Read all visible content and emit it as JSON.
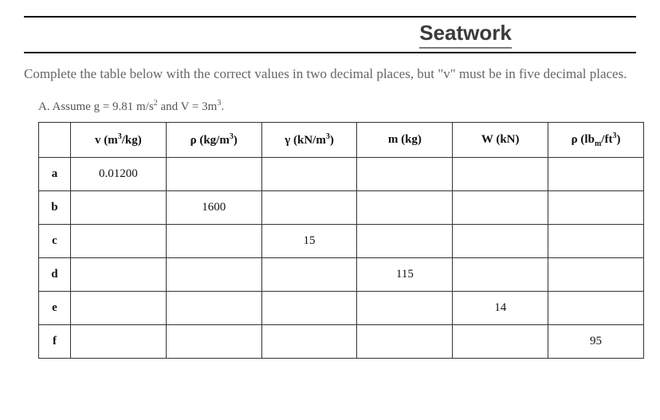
{
  "title": "Seatwork",
  "instructions": "Complete the table below with the correct values in two decimal places, but \"v\" must be in five decimal places.",
  "assume_prefix": "A. Assume g = 9.81 m/s",
  "assume_mid": " and V = 3m",
  "assume_suffix": ".",
  "headers": {
    "v_label": "v (m",
    "v_unit_end": "/kg)",
    "rho_label": "ρ (kg/m",
    "rho_unit_end": ")",
    "gamma_label": "γ (kN/m",
    "gamma_unit_end": ")",
    "m_label": "m (kg)",
    "W_label": "W (kN)",
    "rhoi_label": "ρ (lb",
    "rhoi_sub": "m",
    "rhoi_mid": "/ft",
    "rhoi_end": ")"
  },
  "rows": [
    {
      "label": "a",
      "v": "0.01200",
      "rho": "",
      "gamma": "",
      "m": "",
      "W": "",
      "rhoi": ""
    },
    {
      "label": "b",
      "v": "",
      "rho": "1600",
      "gamma": "",
      "m": "",
      "W": "",
      "rhoi": ""
    },
    {
      "label": "c",
      "v": "",
      "rho": "",
      "gamma": "15",
      "m": "",
      "W": "",
      "rhoi": ""
    },
    {
      "label": "d",
      "v": "",
      "rho": "",
      "gamma": "",
      "m": "115",
      "W": "",
      "rhoi": ""
    },
    {
      "label": "e",
      "v": "",
      "rho": "",
      "gamma": "",
      "m": "",
      "W": "14",
      "rhoi": ""
    },
    {
      "label": "f",
      "v": "",
      "rho": "",
      "gamma": "",
      "m": "",
      "W": "",
      "rhoi": "95"
    }
  ],
  "chart_data": {
    "type": "table",
    "title": "Seatwork",
    "columns": [
      "v (m³/kg)",
      "ρ (kg/m³)",
      "γ (kN/m³)",
      "m (kg)",
      "W (kN)",
      "ρ (lbm/ft³)"
    ],
    "rows": {
      "a": [
        0.012,
        null,
        null,
        null,
        null,
        null
      ],
      "b": [
        null,
        1600,
        null,
        null,
        null,
        null
      ],
      "c": [
        null,
        null,
        15,
        null,
        null,
        null
      ],
      "d": [
        null,
        null,
        null,
        115,
        null,
        null
      ],
      "e": [
        null,
        null,
        null,
        null,
        14,
        null
      ],
      "f": [
        null,
        null,
        null,
        null,
        null,
        95
      ]
    },
    "constants": {
      "g": 9.81,
      "g_unit": "m/s²",
      "V": 3,
      "V_unit": "m³"
    }
  }
}
